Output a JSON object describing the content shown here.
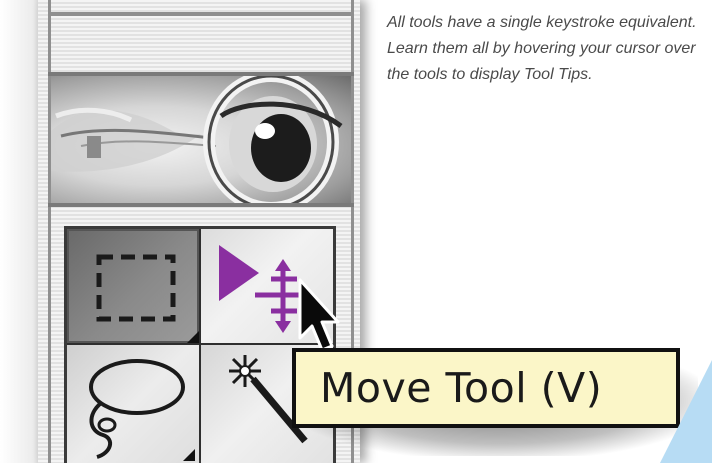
{
  "description": "All tools have a single keystroke equivalent. Learn them all by hovering your cursor over the tools to display Tool Tips.",
  "tooltip": {
    "text": "Move Tool (V)"
  },
  "palette": {
    "logo_icon": "photoshop-eye-icon",
    "tools": [
      {
        "id": "marquee",
        "icon": "rectangular-marquee-icon",
        "selected": true,
        "has_flyout": true
      },
      {
        "id": "move",
        "icon": "move-tool-icon",
        "selected": false,
        "has_flyout": false
      },
      {
        "id": "lasso",
        "icon": "lasso-icon",
        "selected": false,
        "has_flyout": true
      },
      {
        "id": "magic-wand",
        "icon": "magic-wand-icon",
        "selected": false,
        "has_flyout": false
      }
    ]
  },
  "colors": {
    "tooltip_background": "#fbf6c8",
    "move_tool_icon": "#8a2fa0",
    "text": "#4a4a4a",
    "accent": "#b7dcf4"
  }
}
